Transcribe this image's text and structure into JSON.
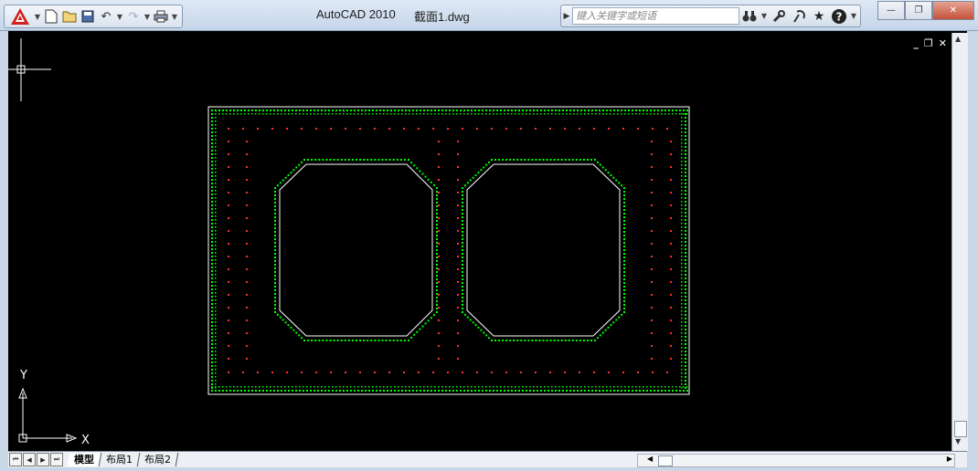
{
  "window": {
    "app_title": "AutoCAD 2010",
    "file_title": "截面1.dwg",
    "minimize": "—",
    "restore": "❐",
    "close": "✕"
  },
  "quick_access": {
    "new_icon": "▯",
    "open_icon": "📂",
    "save_icon": "💾",
    "undo_icon": "↶",
    "redo_icon": "↷",
    "print_icon": "🖶",
    "dropdown": "▼"
  },
  "search": {
    "placeholder": "键入关键字或短语",
    "expand_icon": "▶",
    "binoculars_icon": "⌕",
    "subscription_icon": "🔧",
    "comm_center_icon": "📡",
    "favorites_icon": "★",
    "help_icon": "?",
    "dropdown": "▼"
  },
  "drawing": {
    "doc_minimize": "_",
    "doc_restore": "❐",
    "doc_close": "✕",
    "ucs_y": "Y",
    "ucs_x": "X",
    "colors": {
      "background": "#000000",
      "outline": "#ffffff",
      "stirrup_dots": "#00ff00",
      "rebar_dots": "#ff0000"
    }
  },
  "tabs": {
    "items": [
      {
        "label": "模型",
        "active": true
      },
      {
        "label": "布局1",
        "active": false
      },
      {
        "label": "布局2",
        "active": false
      }
    ],
    "nav_first": "⏮",
    "nav_prev": "◀",
    "nav_next": "▶",
    "nav_last": "⏭"
  }
}
